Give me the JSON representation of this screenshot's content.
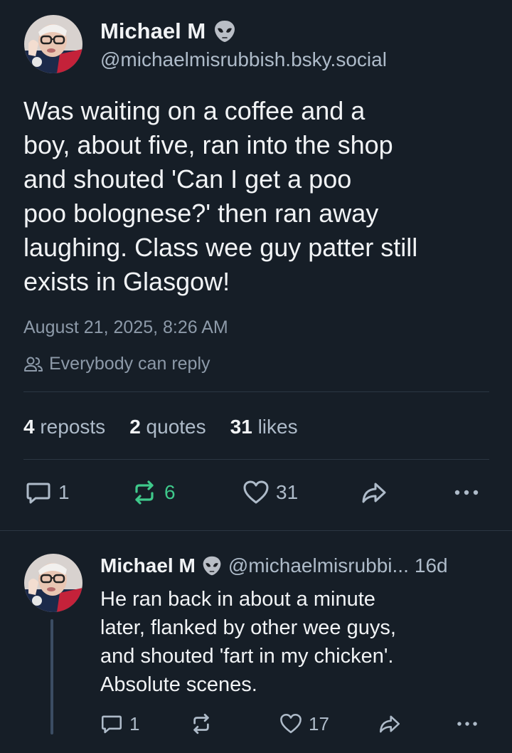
{
  "post": {
    "author_name": "Michael M",
    "author_handle": "@michaelmisrubbish.bsky.social",
    "badge_icon": "alien-emoji",
    "text_lines": [
      "Was waiting on a coffee and a",
      "boy, about five, ran into the shop",
      "and shouted 'Can I get a poo",
      "poo bolognese?' then ran away",
      "laughing. Class wee guy patter still",
      "exists in Glasgow!"
    ],
    "timestamp": "August 21, 2025, 8:26 AM",
    "reply_setting": "Everybody can reply",
    "stats": {
      "reposts_count": "4",
      "reposts_label": "reposts",
      "quotes_count": "2",
      "quotes_label": "quotes",
      "likes_count": "31",
      "likes_label": "likes"
    },
    "actions": {
      "reply_count": "1",
      "repost_count": "6",
      "like_count": "31"
    }
  },
  "reply": {
    "author_name": "Michael M",
    "author_handle": "@michaelmisrubbi...",
    "age": "16d",
    "text_lines": [
      "He ran back in about a minute",
      "later, flanked by other wee guys,",
      "and shouted 'fart in my chicken'.",
      "Absolute scenes."
    ],
    "actions": {
      "reply_count": "1",
      "repost_count": "",
      "like_count": "17"
    }
  },
  "colors": {
    "background": "#161e27",
    "text_primary": "#f1f3f5",
    "text_secondary": "#aebbc9",
    "reposted_accent": "#3fc98b",
    "divider": "#2b3642"
  }
}
